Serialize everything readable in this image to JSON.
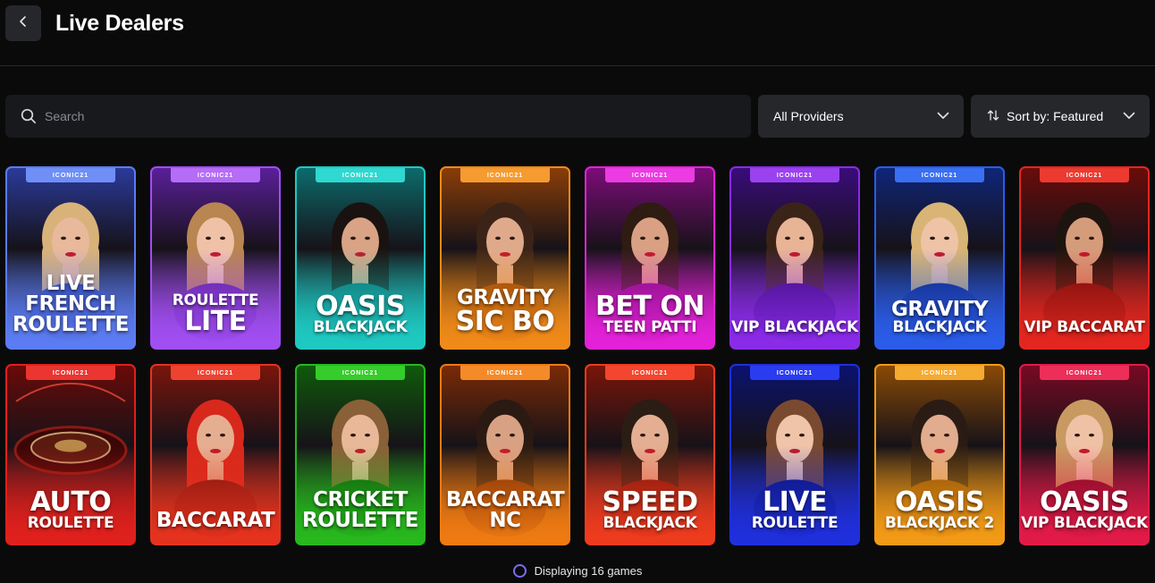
{
  "header": {
    "title": "Live Dealers"
  },
  "search": {
    "placeholder": "Search"
  },
  "filters": {
    "providers_label": "All Providers",
    "sort_label": "Sort by: Featured"
  },
  "provider_tag": "ICONIC21",
  "games": [
    {
      "line1": "LIVE FRENCH",
      "line2": "ROULETTE",
      "color": "#5b7cf2",
      "dark": "#2a3a9a",
      "tag": "#6f8ff7",
      "skin": "#e9b99c",
      "hair": "#d9b27a",
      "size1": "t-med",
      "size2": "t-med"
    },
    {
      "line1": "ROULETTE",
      "line2": "LITE",
      "color": "#a14ef2",
      "dark": "#5a1f9a",
      "tag": "#b56cf7",
      "skin": "#efc2a8",
      "hair": "#b98551",
      "size1": "t-small",
      "size2": "t-big"
    },
    {
      "line1": "OASIS",
      "line2": "BLACKJACK",
      "color": "#1ec9c2",
      "dark": "#0c6b6c",
      "tag": "#2fd8d0",
      "skin": "#d9a385",
      "hair": "#1a1210",
      "size1": "t-big",
      "size2": "t-small"
    },
    {
      "line1": "GRAVITY",
      "line2": "SIC BO",
      "color": "#f08a18",
      "dark": "#8a3d08",
      "tag": "#f59b30",
      "skin": "#dfaa8c",
      "hair": "#3b2417",
      "size1": "t-med",
      "size2": "t-big"
    },
    {
      "line1": "BET ON",
      "line2": "TEEN PATTI",
      "color": "#e321d8",
      "dark": "#7c0c79",
      "tag": "#ec3be2",
      "skin": "#d9a083",
      "hair": "#2e1b12",
      "size1": "t-big",
      "size2": "t-small"
    },
    {
      "line1": "VIP BLACKJACK",
      "line2": "",
      "color": "#8a2be8",
      "dark": "#3a0c7a",
      "tag": "#9a42f0",
      "skin": "#e8b496",
      "hair": "#3a2418",
      "size1": "t-small",
      "size2": "t-small"
    },
    {
      "line1": "GRAVITY",
      "line2": "BLACKJACK",
      "color": "#2a5ce8",
      "dark": "#0f2578",
      "tag": "#3a6ff2",
      "skin": "#efc3a6",
      "hair": "#d8b575",
      "size1": "t-med",
      "size2": "t-small"
    },
    {
      "line1": "VIP BACCARAT",
      "line2": "",
      "color": "#e3261f",
      "dark": "#6a0c0a",
      "tag": "#ec3a30",
      "skin": "#d59c7c",
      "hair": "#1e140f",
      "size1": "t-small",
      "size2": "t-small"
    },
    {
      "line1": "AUTO",
      "line2": "ROULETTE",
      "color": "#e0201c",
      "dark": "#6a0a08",
      "tag": "#ea3530",
      "skin": "",
      "hair": "",
      "size1": "t-big",
      "size2": "t-small"
    },
    {
      "line1": "BACCARAT",
      "line2": "",
      "color": "#e5321e",
      "dark": "#7a150c",
      "tag": "#ee4230",
      "skin": "#e6ae90",
      "hair": "#d8281c",
      "size1": "t-med",
      "size2": "t-small"
    },
    {
      "line1": "CRICKET",
      "line2": "ROULETTE",
      "color": "#27b81d",
      "dark": "#0f5a0c",
      "tag": "#36cc2a",
      "skin": "#e9b898",
      "hair": "#8a6038",
      "size1": "t-med",
      "size2": "t-med"
    },
    {
      "line1": "BACCARAT NC",
      "line2": "",
      "color": "#ef7a12",
      "dark": "#7a2a06",
      "tag": "#f58a28",
      "skin": "#d9a184",
      "hair": "#2a1a12",
      "size1": "t-med",
      "size2": "t-small"
    },
    {
      "line1": "SPEED",
      "line2": "BLACKJACK",
      "color": "#ee3b1e",
      "dark": "#7a1509",
      "tag": "#f2462e",
      "skin": "#e4ae92",
      "hair": "#2b1c14",
      "size1": "t-big",
      "size2": "t-small"
    },
    {
      "line1": "LIVE",
      "line2": "ROULETTE",
      "color": "#1f2fdc",
      "dark": "#0b126e",
      "tag": "#2a3cef",
      "skin": "#efc4a8",
      "hair": "#7a4a30",
      "size1": "t-big",
      "size2": "t-small"
    },
    {
      "line1": "OASIS",
      "line2": "BLACKJACK 2",
      "color": "#f29a16",
      "dark": "#8a4a06",
      "tag": "#f5aa30",
      "skin": "#e2ac8e",
      "hair": "#2a1c14",
      "size1": "t-big",
      "size2": "t-small"
    },
    {
      "line1": "OASIS",
      "line2": "VIP BLACKJACK",
      "color": "#e21a48",
      "dark": "#780a22",
      "tag": "#ec2e58",
      "skin": "#efc2a6",
      "hair": "#c89a62",
      "size1": "t-big",
      "size2": "t-small"
    }
  ],
  "footer": {
    "status": "Displaying 16 games"
  },
  "icons": {
    "back": "chevron-left-icon",
    "search": "search-icon",
    "dropdown": "chevron-down-icon",
    "sort": "sort-arrows-icon",
    "loading": "loading-ring-icon"
  }
}
